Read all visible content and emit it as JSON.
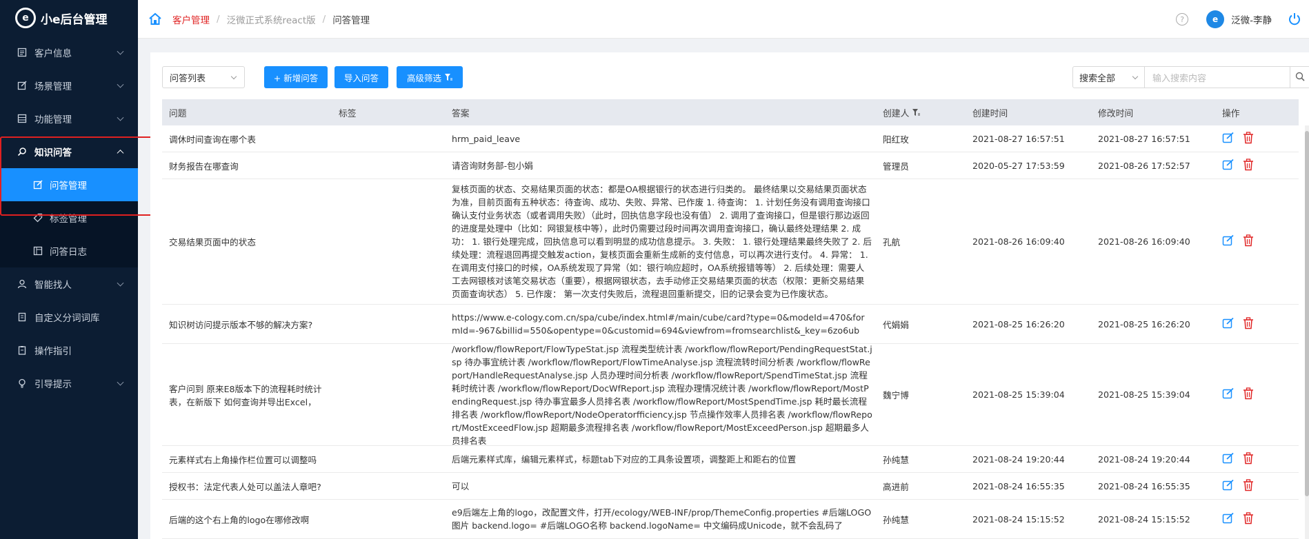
{
  "app": {
    "title": "小e后台管理",
    "logo_letter": "e"
  },
  "sidebar": {
    "items": [
      {
        "label": "客户信息",
        "icon": "list-icon"
      },
      {
        "label": "场景管理",
        "icon": "edit-icon"
      },
      {
        "label": "功能管理",
        "icon": "table-icon"
      },
      {
        "label": "知识问答",
        "icon": "search-icon"
      },
      {
        "label": "智能找人",
        "icon": "user-icon"
      },
      {
        "label": "自定义分词词库",
        "icon": "book-icon"
      },
      {
        "label": "操作指引",
        "icon": "clipboard-icon"
      },
      {
        "label": "引导提示",
        "icon": "bulb-icon"
      }
    ],
    "sub_items": [
      {
        "label": "问答管理",
        "icon": "edit-icon"
      },
      {
        "label": "标签管理",
        "icon": "tag-icon"
      },
      {
        "label": "问答日志",
        "icon": "log-icon"
      }
    ]
  },
  "breadcrumb": {
    "c1": "客户管理",
    "c2": "泛微正式系统react版",
    "c3": "问答管理"
  },
  "user": {
    "name": "泛微-李静",
    "avatar_text": "e"
  },
  "toolbar": {
    "list_select": "问答列表",
    "add_label": "+ 新增问答",
    "import_label": "导入问答",
    "filter_label": "高级筛选",
    "search_scope": "搜索全部",
    "search_placeholder": "输入搜索内容"
  },
  "table": {
    "headers": {
      "question": "问题",
      "tag": "标签",
      "answer": "答案",
      "creator": "创建人",
      "created": "创建时间",
      "modified": "修改时间",
      "ops": "操作"
    },
    "rows": [
      {
        "question": "调休时间查询在哪个表",
        "tag": "",
        "answer": "hrm_paid_leave",
        "creator": "阳红玫",
        "created": "2021-08-27 16:57:51",
        "modified": "2021-08-27 16:57:51"
      },
      {
        "question": "财务报告在哪查询",
        "tag": "",
        "answer": "请咨询财务部-包小娟",
        "creator": "管理员",
        "created": "2020-05-27 17:53:59",
        "modified": "2021-08-26 17:52:57"
      },
      {
        "question": "交易结果页面中的状态",
        "tag": "",
        "answer": "复核页面的状态、交易结果页面的状态：都是OA根据银行的状态进行归类的。 最终结果以交易结果页面状态为准，目前页面有五种状态：待查询、成功、失败、异常、已作废 1. 待查询： 1. 计划任务没有调用查询接口确认支付业务状态（或者调用失败）（此时，回执信息字段也没有值） 2. 调用了查询接口，但是银行那边返回的进度是处理中（比如：网银复核中等），此时仍需要过段时间再次调用查询接口，确认最终处理结果 2. 成功： 1. 银行处理完成，回执信息可以看到明显的成功信息提示。 3. 失败： 1. 银行处理结果最终失败了 2. 后续处理：流程退回再提交触发action，复核页面会重新生成新的支付信息，可以再次进行支付。 4. 异常： 1. 在调用支付接口的时候，OA系统发现了异常（如：银行响应超时，OA系统报错等等） 2. 后续处理：需要人工去网银核对该笔交易状态（重要），根据网银状态，去手动修正交易结果页面的状态（权限：更新交易结果页面查询状态） 5. 已作废： 第一次支付失败后，流程退回重新提交，旧的记录会变为已作废状态。",
        "creator": "孔航",
        "created": "2021-08-26 16:09:40",
        "modified": "2021-08-26 16:09:40"
      },
      {
        "question": "知识树访问提示版本不够的解决方案?",
        "tag": "",
        "answer": "https://www.e-cology.com.cn/spa/cube/index.html#/main/cube/card?type=0&modeId=470&formId=-967&billid=550&opentype=0&customid=694&viewfrom=fromsearchlist&_key=6zo6ub",
        "creator": "代娟娟",
        "created": "2021-08-25 16:26:20",
        "modified": "2021-08-25 16:26:20"
      },
      {
        "question": "客户问到 原来E8版本下的流程耗时统计表，在新版下 如何查询并导出Excel，",
        "tag": "",
        "answer": "/workflow/flowReport/FlowTypeStat.jsp 流程类型统计表 /workflow/flowReport/PendingRequestStat.jsp 待办事宜统计表 /workflow/flowReport/FlowTimeAnalyse.jsp 流程流转时间分析表 /workflow/flowReport/HandleRequestAnalyse.jsp 人员办理时间分析表 /workflow/flowReport/SpendTimeStat.jsp 流程耗时统计表 /workflow/flowReport/DocWfReport.jsp 流程办理情况统计表 /workflow/flowReport/MostPendingRequest.jsp 待办事宜最多人员排名表 /workflow/flowReport/MostSpendTime.jsp 耗时最长流程排名表 /workflow/flowReport/NodeOperatorfficiency.jsp 节点操作效率人员排名表 /workflow/flowReport/MostExceedFlow.jsp 超期最多流程排名表 /workflow/flowReport/MostExceedPerson.jsp 超期最多人员排名表",
        "creator": "魏宁博",
        "created": "2021-08-25 15:39:04",
        "modified": "2021-08-25 15:39:04"
      },
      {
        "question": "元素样式右上角操作栏位置可以调整吗",
        "tag": "",
        "answer": "后端元素样式库，编辑元素样式，标题tab下对应的工具条设置项，调整距上和距右的位置",
        "creator": "孙纯慧",
        "created": "2021-08-24 19:20:44",
        "modified": "2021-08-24 19:20:44"
      },
      {
        "question": "授权书：法定代表人处可以盖法人章吧?",
        "tag": "",
        "answer": "可以",
        "creator": "高进前",
        "created": "2021-08-24 16:55:35",
        "modified": "2021-08-24 16:55:35"
      },
      {
        "question": "后端的这个右上角的logo在哪修改啊",
        "tag": "",
        "answer": "e9后端左上角的logo，改配置文件，打开/ecology/WEB-INF/prop/ThemeConfig.properties #后端LOGO图片 backend.logo= #后端LOGO名称 backend.logoName= 中文编码成Unicode，就不会乱码了",
        "creator": "孙纯慧",
        "created": "2021-08-24 15:15:52",
        "modified": "2021-08-24 15:15:52"
      }
    ]
  },
  "colors": {
    "sidebar_bg": "#0c1d33",
    "accent": "#1890ff",
    "danger": "#e02424",
    "header_bg": "#e6e9ef"
  }
}
